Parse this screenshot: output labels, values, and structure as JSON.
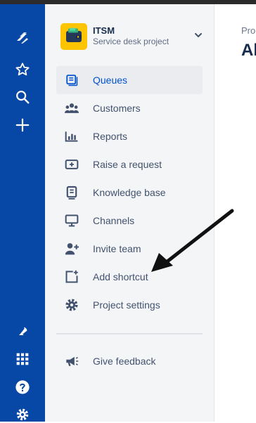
{
  "project": {
    "name": "ITSM",
    "type": "Service desk project"
  },
  "sidebar": {
    "items": [
      {
        "label": "Queues",
        "icon": "queues-icon",
        "selected": true
      },
      {
        "label": "Customers",
        "icon": "customers-icon"
      },
      {
        "label": "Reports",
        "icon": "reports-icon"
      },
      {
        "label": "Raise a request",
        "icon": "raise-request-icon"
      },
      {
        "label": "Knowledge base",
        "icon": "knowledge-base-icon"
      },
      {
        "label": "Channels",
        "icon": "channels-icon"
      },
      {
        "label": "Invite team",
        "icon": "invite-team-icon"
      },
      {
        "label": "Add shortcut",
        "icon": "add-shortcut-icon"
      },
      {
        "label": "Project settings",
        "icon": "gear-icon"
      }
    ],
    "feedback": {
      "label": "Give feedback",
      "icon": "megaphone-icon"
    }
  },
  "main": {
    "breadcrumb": "Pro",
    "title": "Al"
  },
  "colors": {
    "global_nav": "#0747a6",
    "sidebar_bg": "#f4f5f7",
    "selected_bg": "#ebecf0",
    "selected_text": "#0052cc",
    "label_text": "#42526e",
    "project_avatar": "#ffc400"
  }
}
